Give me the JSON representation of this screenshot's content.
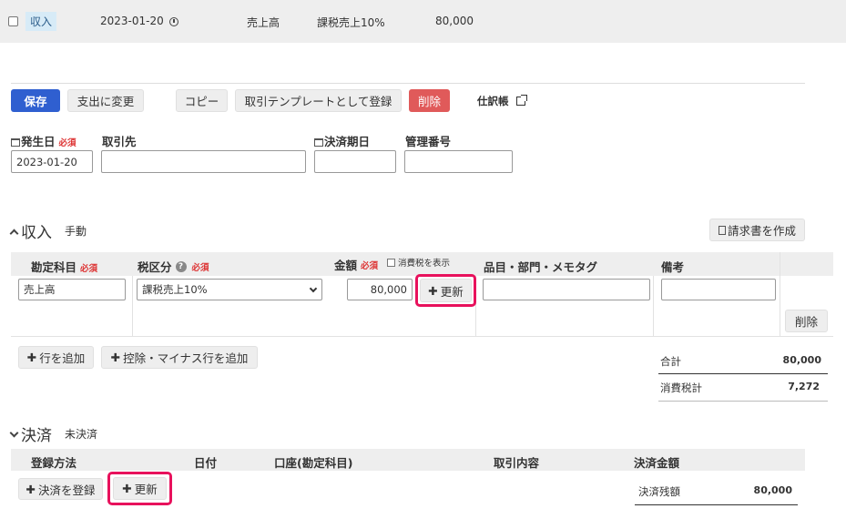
{
  "row": {
    "type_badge": "収入",
    "date": "2023-01-20",
    "account": "売上高",
    "tax": "課税売上10%",
    "amount": "80,000"
  },
  "toolbar": {
    "save": "保存",
    "switch_expense": "支出に変更",
    "copy": "コピー",
    "template": "取引テンプレートとして登録",
    "delete": "削除",
    "journal": "仕訳帳"
  },
  "header_fields": {
    "issue_date_label": "発生日",
    "required": "必須",
    "issue_date_value": "2023-01-20",
    "partner_label": "取引先",
    "partner_value": "",
    "due_date_label": "決済期日",
    "due_date_value": "",
    "mgmt_no_label": "管理番号",
    "mgmt_no_value": ""
  },
  "income": {
    "title": "収入",
    "mode": "手動",
    "create_invoice": "請求書を作成",
    "columns": {
      "account": "勘定科目",
      "tax": "税区分",
      "amount": "金額",
      "show_tax": "消費税を表示",
      "item": "品目・部門・メモタグ",
      "note": "備考"
    },
    "line": {
      "account": "売上高",
      "tax": "課税売上10%",
      "amount": "80,000",
      "update": "更新",
      "item": "",
      "note": "",
      "delete": "削除"
    },
    "add_row": "行を追加",
    "add_deduction": "控除・マイナス行を追加",
    "total_label": "合計",
    "total_value": "80,000",
    "tax_label": "消費税計",
    "tax_value": "7,272"
  },
  "settlement": {
    "title": "決済",
    "status": "未決済",
    "columns": {
      "method": "登録方法",
      "date": "日付",
      "account": "口座(勘定科目)",
      "description": "取引内容",
      "amount": "決済金額"
    },
    "register": "決済を登録",
    "update": "更新",
    "balance_label": "決済残額",
    "balance_value": "80,000"
  },
  "colors": {
    "primary": "#2f5fd0",
    "danger": "#e05a5a",
    "highlight": "#e8115c",
    "required": "#dd3333"
  }
}
